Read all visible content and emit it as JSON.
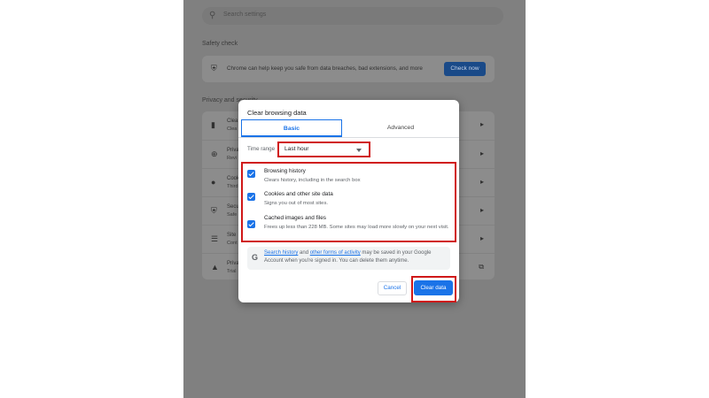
{
  "settings": {
    "search_placeholder": "Search settings",
    "safety_check": {
      "title": "Safety check",
      "text": "Chrome can help keep you safe from data breaches, bad extensions, and more",
      "button": "Check now"
    },
    "privacy": {
      "title": "Privacy and security",
      "rows": [
        {
          "title": "Clea",
          "sub": "Clea",
          "icon": "trash-icon"
        },
        {
          "title": "Priva",
          "sub": "Revi",
          "icon": "privacy-guide-icon"
        },
        {
          "title": "Cook",
          "sub": "Third",
          "icon": "cookie-icon"
        },
        {
          "title": "Secu",
          "sub": "Safe",
          "icon": "shield-icon"
        },
        {
          "title": "Site",
          "sub": "Cont",
          "icon": "site-settings-icon"
        },
        {
          "title": "Priva",
          "sub": "Trial",
          "icon": "flask-icon"
        }
      ]
    }
  },
  "dialog": {
    "title": "Clear browsing data",
    "tabs": [
      "Basic",
      "Advanced"
    ],
    "time_range_label": "Time range",
    "time_range_value": "Last hour",
    "options": [
      {
        "title": "Browsing history",
        "desc": "Clears history, including in the search box",
        "checked": true
      },
      {
        "title": "Cookies and other site data",
        "desc": "Signs you out of most sites.",
        "checked": true
      },
      {
        "title": "Cached images and files",
        "desc": "Frees up less than 228 MB. Some sites may load more slowly on your next visit.",
        "checked": true
      }
    ],
    "google_note": {
      "link1": "Search history",
      "mid": " and ",
      "link2": "other forms of activity",
      "rest": " may be saved in your Google Account when you're signed in. You can delete them anytime."
    },
    "cancel_label": "Cancel",
    "clear_label": "Clear data"
  },
  "colors": {
    "accent": "#1a73e8",
    "highlight": "#d01818"
  }
}
